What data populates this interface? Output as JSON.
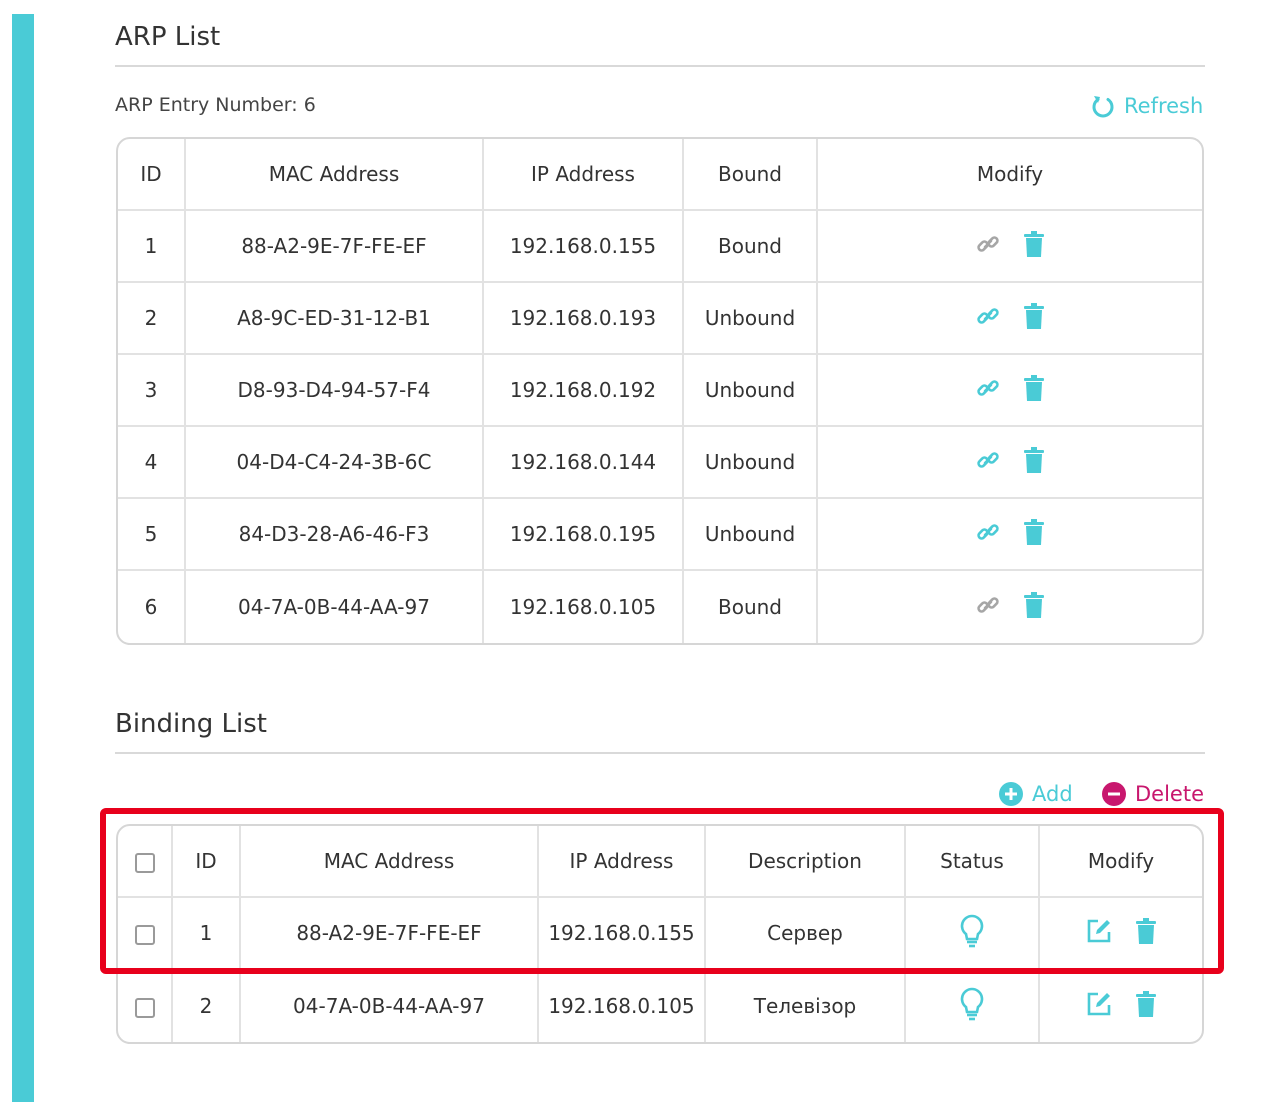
{
  "arp": {
    "title": "ARP List",
    "entry_label": "ARP Entry Number:",
    "entry_count": "6",
    "refresh_label": "Refresh",
    "headers": {
      "id": "ID",
      "mac": "MAC Address",
      "ip": "IP Address",
      "bound": "Bound",
      "modify": "Modify"
    },
    "rows": [
      {
        "id": "1",
        "mac": "88-A2-9E-7F-FE-EF",
        "ip": "192.168.0.155",
        "bound": "Bound"
      },
      {
        "id": "2",
        "mac": "A8-9C-ED-31-12-B1",
        "ip": "192.168.0.193",
        "bound": "Unbound"
      },
      {
        "id": "3",
        "mac": "D8-93-D4-94-57-F4",
        "ip": "192.168.0.192",
        "bound": "Unbound"
      },
      {
        "id": "4",
        "mac": "04-D4-C4-24-3B-6C",
        "ip": "192.168.0.144",
        "bound": "Unbound"
      },
      {
        "id": "5",
        "mac": "84-D3-28-A6-46-F3",
        "ip": "192.168.0.195",
        "bound": "Unbound"
      },
      {
        "id": "6",
        "mac": "04-7A-0B-44-AA-97",
        "ip": "192.168.0.105",
        "bound": "Bound"
      }
    ]
  },
  "binding": {
    "title": "Binding List",
    "add_label": "Add",
    "delete_label": "Delete",
    "headers": {
      "id": "ID",
      "mac": "MAC Address",
      "ip": "IP Address",
      "description": "Description",
      "status": "Status",
      "modify": "Modify"
    },
    "rows": [
      {
        "id": "1",
        "mac": "88-A2-9E-7F-FE-EF",
        "ip": "192.168.0.155",
        "description": "Сервер",
        "status_icon": "lightbulb-icon"
      },
      {
        "id": "2",
        "mac": "04-7A-0B-44-AA-97",
        "ip": "192.168.0.105",
        "description": "Телевізор",
        "status_icon": "lightbulb-icon"
      }
    ]
  },
  "colors": {
    "accent": "#4acbd6",
    "delete": "#c8176e",
    "disabled_icon": "#a6a6a6",
    "highlight": "#e8001c"
  },
  "icons": {
    "link": "link-icon",
    "trash": "trash-icon",
    "edit": "edit-icon",
    "refresh": "refresh-icon",
    "add": "plus-circle-icon",
    "delete": "minus-circle-icon",
    "status": "lightbulb-icon"
  }
}
